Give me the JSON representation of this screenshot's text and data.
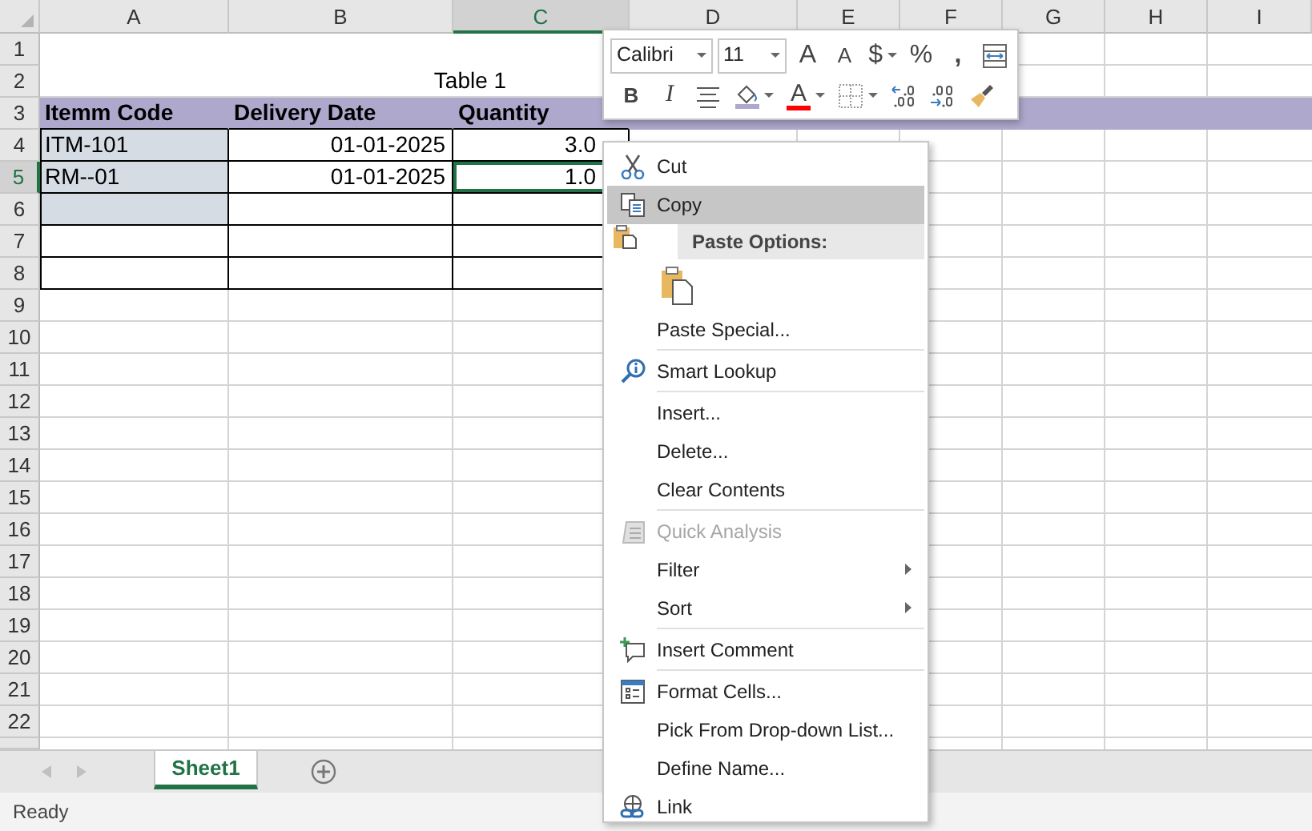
{
  "column_headers": [
    {
      "label": "A",
      "selected": false
    },
    {
      "label": "B",
      "selected": false
    },
    {
      "label": "C",
      "selected": true
    },
    {
      "label": "D",
      "selected": false
    },
    {
      "label": "E",
      "selected": false
    },
    {
      "label": "F",
      "selected": false
    },
    {
      "label": "G",
      "selected": false
    },
    {
      "label": "H",
      "selected": false
    },
    {
      "label": "I",
      "selected": false
    }
  ],
  "row_headers": [
    {
      "label": "1",
      "selected": false
    },
    {
      "label": "2",
      "selected": false
    },
    {
      "label": "3",
      "selected": false
    },
    {
      "label": "4",
      "selected": false
    },
    {
      "label": "5",
      "selected": true
    },
    {
      "label": "6",
      "selected": false
    },
    {
      "label": "7",
      "selected": false
    },
    {
      "label": "8",
      "selected": false
    },
    {
      "label": "9",
      "selected": false
    },
    {
      "label": "10",
      "selected": false
    },
    {
      "label": "11",
      "selected": false
    },
    {
      "label": "12",
      "selected": false
    },
    {
      "label": "13",
      "selected": false
    },
    {
      "label": "14",
      "selected": false
    },
    {
      "label": "15",
      "selected": false
    },
    {
      "label": "16",
      "selected": false
    },
    {
      "label": "17",
      "selected": false
    },
    {
      "label": "18",
      "selected": false
    },
    {
      "label": "19",
      "selected": false
    },
    {
      "label": "20",
      "selected": false
    },
    {
      "label": "21",
      "selected": false
    },
    {
      "label": "22",
      "selected": false
    }
  ],
  "sheet": {
    "title": "Table 1",
    "columns": [
      "Itemm Code",
      "Delivery Date",
      "Quantity"
    ],
    "rows": [
      {
        "cells": [
          {
            "text": "ITM-101",
            "shaded": true,
            "selected": false
          },
          {
            "text": "01-01-2025",
            "shaded": false,
            "selected": false
          },
          {
            "text": "3.0",
            "shaded": false,
            "selected": false
          }
        ]
      },
      {
        "cells": [
          {
            "text": "RM--01",
            "shaded": true,
            "selected": false
          },
          {
            "text": "01-01-2025",
            "shaded": false,
            "selected": false
          },
          {
            "text": "1.0",
            "shaded": false,
            "selected": true
          }
        ]
      },
      {
        "cells": [
          {
            "shaded": true,
            "selected": false
          },
          {
            "shaded": false,
            "selected": false
          },
          {
            "shaded": false,
            "selected": false
          }
        ]
      },
      {
        "cells": [
          {
            "shaded": false,
            "selected": false
          },
          {
            "shaded": false,
            "selected": false
          },
          {
            "shaded": false,
            "selected": false
          }
        ]
      },
      {
        "cells": [
          {
            "shaded": false,
            "selected": false
          },
          {
            "shaded": false,
            "selected": false
          },
          {
            "shaded": false,
            "selected": false
          }
        ]
      }
    ]
  },
  "mini_toolbar": {
    "font": "Calibri",
    "size": "11",
    "row_1": [
      {
        "kind": "grow",
        "label": "A",
        "dropdown": false
      },
      {
        "kind": "shrink",
        "label": "A",
        "dropdown": false
      },
      {
        "kind": "glyph",
        "label": "$",
        "dropdown": true
      },
      {
        "kind": "glyph",
        "label": "%",
        "dropdown": false
      },
      {
        "kind": "comma",
        "label": ",",
        "dropdown": false
      },
      {
        "kind": "wrap",
        "dropdown": false
      }
    ],
    "row_2": [
      {
        "kind": "bold",
        "label": "B",
        "dropdown": false
      },
      {
        "kind": "italic",
        "label": "I",
        "dropdown": false
      },
      {
        "kind": "align",
        "dropdown": false
      },
      {
        "kind": "fill",
        "color": "#aea8cd",
        "dropdown": true
      },
      {
        "kind": "fontcolor",
        "label": "A",
        "color": "#ff0000",
        "dropdown": true
      },
      {
        "kind": "borders",
        "dropdown": true
      },
      {
        "kind": "incdecimal",
        "dropdown": false
      },
      {
        "kind": "decdecimal",
        "dropdown": false
      },
      {
        "kind": "painter",
        "dropdown": false
      }
    ]
  },
  "context_menu": {
    "items": [
      {
        "kind": "scissors",
        "label": "Cut",
        "selected": false,
        "disabled": false,
        "submenu": false
      },
      {
        "kind": "copy",
        "label": "Copy",
        "selected": true,
        "disabled": false,
        "submenu": false
      },
      {
        "kind": "header",
        "label": "Paste Options:"
      },
      {
        "kind": "paste"
      },
      {
        "kind": "plain",
        "label": "Paste Special...",
        "selected": false,
        "disabled": false,
        "submenu": false
      },
      {
        "kind": "separator"
      },
      {
        "kind": "lookup",
        "label": "Smart Lookup",
        "selected": false,
        "disabled": false,
        "submenu": false
      },
      {
        "kind": "separator"
      },
      {
        "kind": "plain",
        "label": "Insert...",
        "selected": false,
        "disabled": false,
        "submenu": false
      },
      {
        "kind": "plain",
        "label": "Delete...",
        "selected": false,
        "disabled": false,
        "submenu": false
      },
      {
        "kind": "plain",
        "label": "Clear Contents",
        "selected": false,
        "disabled": false,
        "submenu": false
      },
      {
        "kind": "separator"
      },
      {
        "kind": "analysis",
        "label": "Quick Analysis",
        "selected": false,
        "disabled": true,
        "submenu": false
      },
      {
        "kind": "plain",
        "label": "Filter",
        "selected": false,
        "disabled": false,
        "submenu": true
      },
      {
        "kind": "plain",
        "label": "Sort",
        "selected": false,
        "disabled": false,
        "submenu": true
      },
      {
        "kind": "separator"
      },
      {
        "kind": "comment",
        "label": "Insert Comment",
        "selected": false,
        "disabled": false,
        "submenu": false
      },
      {
        "kind": "separator"
      },
      {
        "kind": "format",
        "label": "Format Cells...",
        "selected": false,
        "disabled": false,
        "submenu": false
      },
      {
        "kind": "plain",
        "label": "Pick From Drop-down List...",
        "selected": false,
        "disabled": false,
        "submenu": false
      },
      {
        "kind": "plain",
        "label": "Define Name...",
        "selected": false,
        "disabled": false,
        "submenu": false
      },
      {
        "kind": "link",
        "label": "Link",
        "selected": false,
        "disabled": false,
        "submenu": false
      }
    ]
  },
  "sheet_tabs": [
    {
      "label": "Sheet1",
      "selected": true
    }
  ],
  "status_bar": {
    "text": "Ready"
  }
}
